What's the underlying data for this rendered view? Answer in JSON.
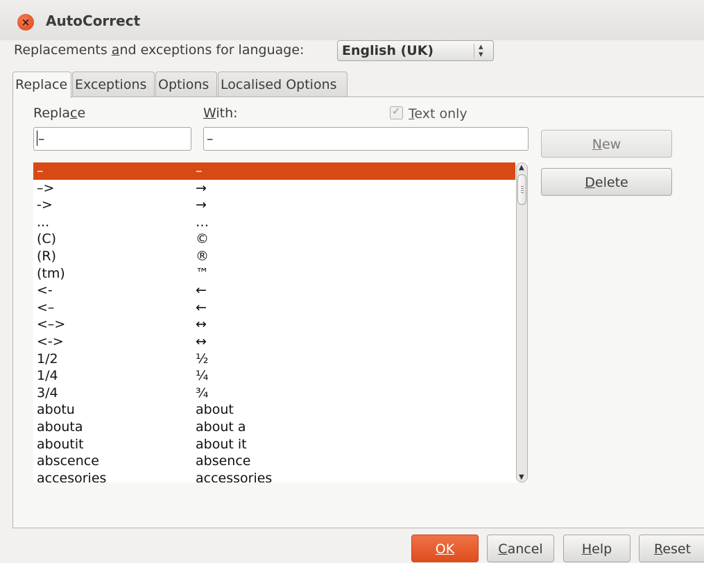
{
  "window": {
    "title": "AutoCorrect"
  },
  "language": {
    "label": "Replacements and exceptions for language:",
    "selected": "English (UK)"
  },
  "tabs": [
    {
      "label": "Replace"
    },
    {
      "label": "Exceptions"
    },
    {
      "label": "Options"
    },
    {
      "label": "Localised Options"
    }
  ],
  "replace_tab": {
    "replace_header": "Replace",
    "with_header": "With:",
    "text_only_label": "Text only",
    "text_only_checked": true,
    "replace_value": "–",
    "with_value": "–",
    "new_label": "New",
    "delete_label": "Delete",
    "rows": [
      {
        "replace": "–",
        "with": "–"
      },
      {
        "replace": "–>",
        "with": "→"
      },
      {
        "replace": "->",
        "with": "→"
      },
      {
        "replace": "...",
        "with": "…"
      },
      {
        "replace": "(C)",
        "with": "©"
      },
      {
        "replace": "(R)",
        "with": "®"
      },
      {
        "replace": "(tm)",
        "with": "™"
      },
      {
        "replace": "<-",
        "with": "←"
      },
      {
        "replace": "<–",
        "with": "←"
      },
      {
        "replace": "<–>",
        "with": "↔"
      },
      {
        "replace": "<->",
        "with": "↔"
      },
      {
        "replace": "1/2",
        "with": "½"
      },
      {
        "replace": "1/4",
        "with": "¼"
      },
      {
        "replace": "3/4",
        "with": "¾"
      },
      {
        "replace": "abotu",
        "with": "about"
      },
      {
        "replace": "abouta",
        "with": "about a"
      },
      {
        "replace": "aboutit",
        "with": "about it"
      },
      {
        "replace": "abscence",
        "with": "absence"
      },
      {
        "replace": "accesories",
        "with": "accessories"
      }
    ]
  },
  "footer": {
    "ok_label": "OK",
    "cancel_label": "Cancel",
    "help_label": "Help",
    "reset_label": "Reset"
  },
  "colors": {
    "accent": "#dd4814",
    "ok_button": "#e95c2c"
  }
}
